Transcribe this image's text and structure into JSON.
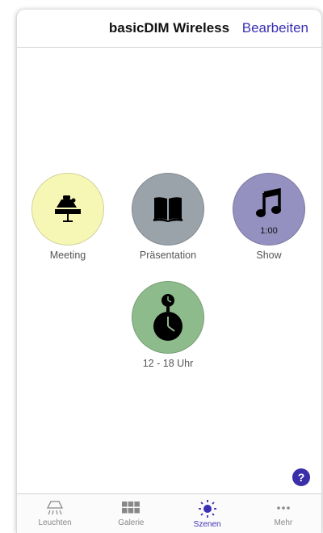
{
  "header": {
    "title": "basicDIM Wireless",
    "edit_label": "Bearbeiten"
  },
  "scenes": [
    {
      "label": "Meeting",
      "color": "#f6f7b5",
      "icon": "desk-lamp-icon"
    },
    {
      "label": "Präsentation",
      "color": "#9aa3aa",
      "icon": "book-icon"
    },
    {
      "label": "Show",
      "color": "#9490bf",
      "icon": "music-note-icon",
      "duration": "1:00"
    },
    {
      "label": "12 - 18 Uhr",
      "color": "#8ebb8b",
      "icon": "timer-clock-icon"
    }
  ],
  "help_label": "?",
  "tabbar": {
    "items": [
      {
        "label": "Leuchten",
        "icon": "ceiling-light-icon"
      },
      {
        "label": "Galerie",
        "icon": "grid-icon"
      },
      {
        "label": "Szenen",
        "icon": "sun-icon",
        "active": true
      },
      {
        "label": "Mehr",
        "icon": "more-dots-icon"
      }
    ]
  },
  "colors": {
    "accent": "#3b2fb4",
    "help_button": "#3a2fa8"
  }
}
